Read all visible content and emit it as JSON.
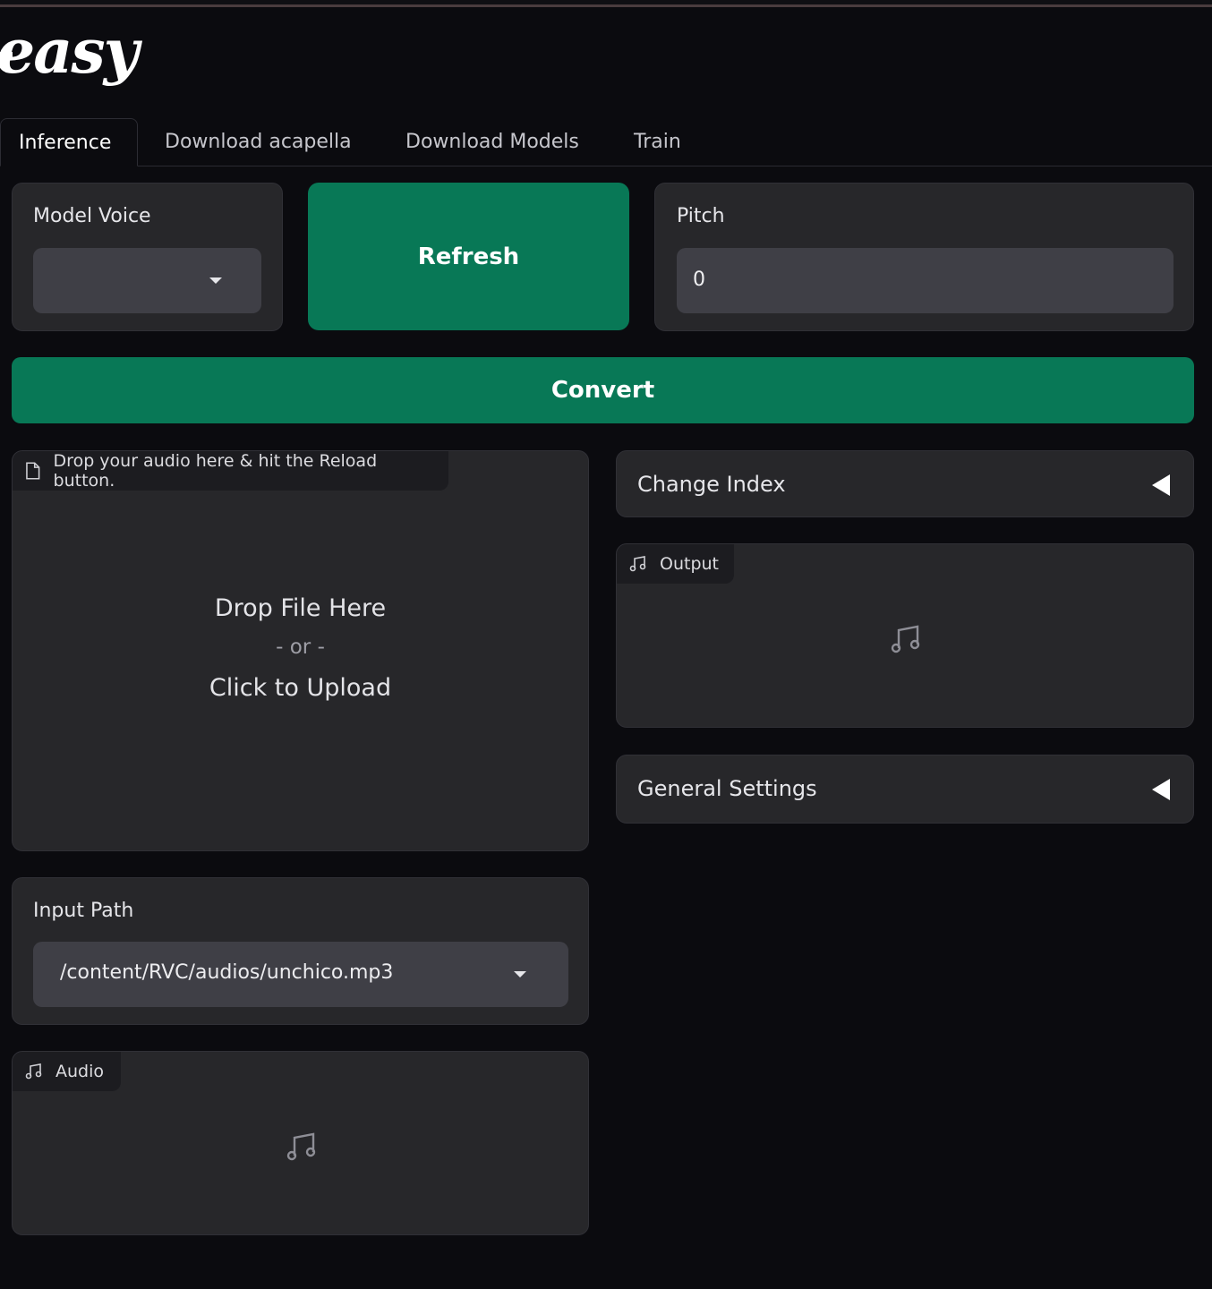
{
  "app": {
    "logo_text": "easy"
  },
  "tabs": [
    {
      "label": "Inference",
      "active": true
    },
    {
      "label": "Download acapella",
      "active": false
    },
    {
      "label": "Download Models",
      "active": false
    },
    {
      "label": "Train",
      "active": false
    }
  ],
  "model_voice": {
    "label": "Model Voice",
    "value": ""
  },
  "refresh": {
    "label": "Refresh"
  },
  "pitch": {
    "label": "Pitch",
    "value": "0"
  },
  "convert": {
    "label": "Convert"
  },
  "upload": {
    "chip_label": "Drop your audio here & hit the Reload button.",
    "drop_text": "Drop File Here",
    "or_text": "- or -",
    "click_text": "Click to Upload"
  },
  "input_path": {
    "label": "Input Path",
    "value": "/content/RVC/audios/unchico.mp3"
  },
  "audio": {
    "chip_label": "Audio"
  },
  "change_index": {
    "label": "Change Index"
  },
  "output": {
    "chip_label": "Output"
  },
  "general_settings": {
    "label": "General Settings"
  },
  "colors": {
    "accent": "#087856",
    "panel": "#27272a",
    "field": "#3f3f46",
    "background": "#0b0b0f"
  },
  "icons": [
    "file-icon",
    "music-note-icon",
    "caret-down-icon",
    "triangle-left-icon"
  ]
}
